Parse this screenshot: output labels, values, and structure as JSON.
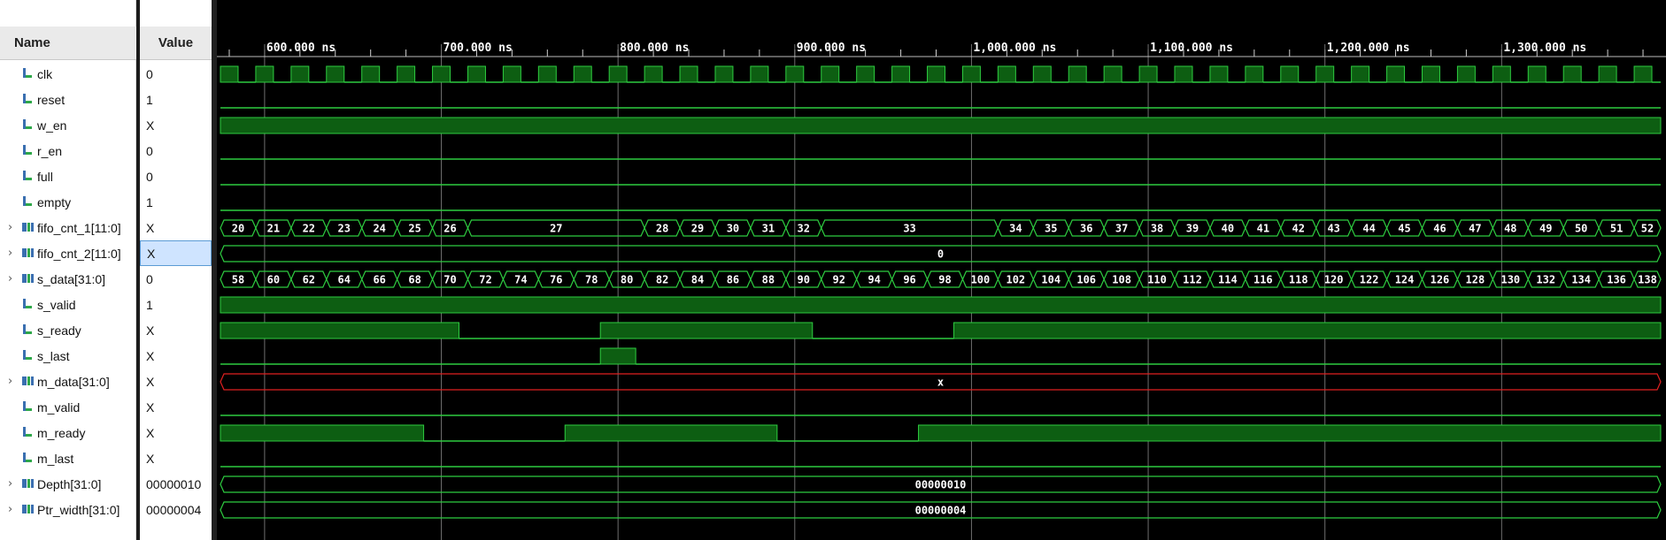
{
  "header": {
    "name": "Name",
    "value": "Value"
  },
  "time_axis": {
    "ticks": [
      "600.000 ns",
      "700.000 ns",
      "800.000 ns",
      "900.000 ns",
      "1,000.000 ns",
      "1,100.000 ns",
      "1,200.000 ns",
      "1,300.000 ns"
    ]
  },
  "signals": [
    {
      "name": "clk",
      "value": "0",
      "kind": "bit",
      "expandable": false
    },
    {
      "name": "reset",
      "value": "1",
      "kind": "bit",
      "expandable": false
    },
    {
      "name": "w_en",
      "value": "X",
      "kind": "bit",
      "expandable": false
    },
    {
      "name": "r_en",
      "value": "0",
      "kind": "bit",
      "expandable": false
    },
    {
      "name": "full",
      "value": "0",
      "kind": "bit",
      "expandable": false
    },
    {
      "name": "empty",
      "value": "1",
      "kind": "bit",
      "expandable": false
    },
    {
      "name": "fifo_cnt_1[11:0]",
      "value": "X",
      "kind": "bus",
      "expandable": true
    },
    {
      "name": "fifo_cnt_2[11:0]",
      "value": "X",
      "kind": "bus",
      "expandable": true,
      "selected": true
    },
    {
      "name": "s_data[31:0]",
      "value": "0",
      "kind": "bus",
      "expandable": true
    },
    {
      "name": "s_valid",
      "value": "1",
      "kind": "bit",
      "expandable": false
    },
    {
      "name": "s_ready",
      "value": "X",
      "kind": "bit",
      "expandable": false
    },
    {
      "name": "s_last",
      "value": "X",
      "kind": "bit",
      "expandable": false
    },
    {
      "name": "m_data[31:0]",
      "value": "X",
      "kind": "bus",
      "expandable": true
    },
    {
      "name": "m_valid",
      "value": "X",
      "kind": "bit",
      "expandable": false
    },
    {
      "name": "m_ready",
      "value": "X",
      "kind": "bit",
      "expandable": false
    },
    {
      "name": "m_last",
      "value": "X",
      "kind": "bit",
      "expandable": false
    },
    {
      "name": "Depth[31:0]",
      "value": "00000010",
      "kind": "bus",
      "expandable": true
    },
    {
      "name": "Ptr_width[31:0]",
      "value": "00000004",
      "kind": "bus",
      "expandable": true
    }
  ],
  "waveforms": {
    "time_range_ns": [
      575,
      1390
    ],
    "clk": {
      "first_rise_ns": 575,
      "period_ns": 20
    },
    "reset": [
      {
        "t": 575,
        "v": "0"
      }
    ],
    "w_en": [
      {
        "t": 575,
        "v": "X"
      }
    ],
    "r_en": [
      {
        "t": 575,
        "v": "0"
      }
    ],
    "full": [
      {
        "t": 575,
        "v": "0"
      }
    ],
    "empty": [
      {
        "t": 575,
        "v": "0"
      }
    ],
    "fifo_cnt_1": [
      {
        "t": 575,
        "v": "20"
      },
      {
        "t": 595,
        "v": "21"
      },
      {
        "t": 615,
        "v": "22"
      },
      {
        "t": 635,
        "v": "23"
      },
      {
        "t": 655,
        "v": "24"
      },
      {
        "t": 675,
        "v": "25"
      },
      {
        "t": 695,
        "v": "26"
      },
      {
        "t": 715,
        "v": "27"
      },
      {
        "t": 815,
        "v": "28"
      },
      {
        "t": 835,
        "v": "29"
      },
      {
        "t": 855,
        "v": "30"
      },
      {
        "t": 875,
        "v": "31"
      },
      {
        "t": 895,
        "v": "32"
      },
      {
        "t": 915,
        "v": "33"
      },
      {
        "t": 1015,
        "v": "34"
      },
      {
        "t": 1035,
        "v": "35"
      },
      {
        "t": 1055,
        "v": "36"
      },
      {
        "t": 1075,
        "v": "37"
      },
      {
        "t": 1095,
        "v": "38"
      },
      {
        "t": 1115,
        "v": "39"
      },
      {
        "t": 1135,
        "v": "40"
      },
      {
        "t": 1155,
        "v": "41"
      },
      {
        "t": 1175,
        "v": "42"
      },
      {
        "t": 1195,
        "v": "43"
      },
      {
        "t": 1215,
        "v": "44"
      },
      {
        "t": 1235,
        "v": "45"
      },
      {
        "t": 1255,
        "v": "46"
      },
      {
        "t": 1275,
        "v": "47"
      },
      {
        "t": 1295,
        "v": "48"
      },
      {
        "t": 1315,
        "v": "49"
      },
      {
        "t": 1335,
        "v": "50"
      },
      {
        "t": 1355,
        "v": "51"
      },
      {
        "t": 1375,
        "v": "52"
      }
    ],
    "fifo_cnt_2": [
      {
        "t": 575,
        "v": "0"
      }
    ],
    "s_data": [
      {
        "t": 575,
        "v": "58"
      },
      {
        "t": 595,
        "v": "60"
      },
      {
        "t": 615,
        "v": "62"
      },
      {
        "t": 635,
        "v": "64"
      },
      {
        "t": 655,
        "v": "66"
      },
      {
        "t": 675,
        "v": "68"
      },
      {
        "t": 695,
        "v": "70"
      },
      {
        "t": 715,
        "v": "72"
      },
      {
        "t": 735,
        "v": "74"
      },
      {
        "t": 755,
        "v": "76"
      },
      {
        "t": 775,
        "v": "78"
      },
      {
        "t": 795,
        "v": "80"
      },
      {
        "t": 815,
        "v": "82"
      },
      {
        "t": 835,
        "v": "84"
      },
      {
        "t": 855,
        "v": "86"
      },
      {
        "t": 875,
        "v": "88"
      },
      {
        "t": 895,
        "v": "90"
      },
      {
        "t": 915,
        "v": "92"
      },
      {
        "t": 935,
        "v": "94"
      },
      {
        "t": 955,
        "v": "96"
      },
      {
        "t": 975,
        "v": "98"
      },
      {
        "t": 995,
        "v": "100"
      },
      {
        "t": 1015,
        "v": "102"
      },
      {
        "t": 1035,
        "v": "104"
      },
      {
        "t": 1055,
        "v": "106"
      },
      {
        "t": 1075,
        "v": "108"
      },
      {
        "t": 1095,
        "v": "110"
      },
      {
        "t": 1115,
        "v": "112"
      },
      {
        "t": 1135,
        "v": "114"
      },
      {
        "t": 1155,
        "v": "116"
      },
      {
        "t": 1175,
        "v": "118"
      },
      {
        "t": 1195,
        "v": "120"
      },
      {
        "t": 1215,
        "v": "122"
      },
      {
        "t": 1235,
        "v": "124"
      },
      {
        "t": 1255,
        "v": "126"
      },
      {
        "t": 1275,
        "v": "128"
      },
      {
        "t": 1295,
        "v": "130"
      },
      {
        "t": 1315,
        "v": "132"
      },
      {
        "t": 1335,
        "v": "134"
      },
      {
        "t": 1355,
        "v": "136"
      },
      {
        "t": 1375,
        "v": "138"
      }
    ],
    "s_valid": [
      {
        "t": 575,
        "v": "1"
      }
    ],
    "s_ready": [
      {
        "t": 575,
        "v": "1"
      },
      {
        "t": 710,
        "v": "0"
      },
      {
        "t": 790,
        "v": "1"
      },
      {
        "t": 910,
        "v": "0"
      },
      {
        "t": 990,
        "v": "1"
      }
    ],
    "s_last": [
      {
        "t": 575,
        "v": "0"
      },
      {
        "t": 790,
        "v": "1"
      },
      {
        "t": 810,
        "v": "0"
      }
    ],
    "m_data": [
      {
        "t": 575,
        "v": "x"
      }
    ],
    "m_valid": [
      {
        "t": 575,
        "v": "0"
      }
    ],
    "m_ready": [
      {
        "t": 575,
        "v": "1"
      },
      {
        "t": 690,
        "v": "0"
      },
      {
        "t": 770,
        "v": "1"
      },
      {
        "t": 890,
        "v": "0"
      },
      {
        "t": 970,
        "v": "1"
      }
    ],
    "m_last": [
      {
        "t": 575,
        "v": "0"
      }
    ],
    "Depth": [
      {
        "t": 575,
        "v": "00000010"
      }
    ],
    "Ptr_width": [
      {
        "t": 575,
        "v": "00000004"
      }
    ]
  },
  "colors": {
    "wave_line": "#2ecc40",
    "wave_fill": "#0d5e12",
    "unknown_line": "#e02020",
    "grid": "#6e6e6e",
    "text": "#ffffff",
    "background": "#000000"
  }
}
